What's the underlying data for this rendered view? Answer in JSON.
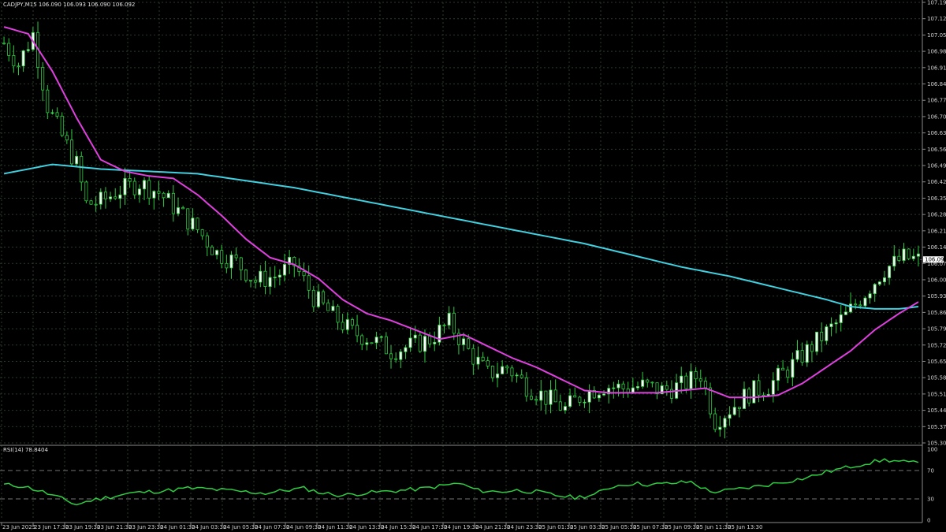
{
  "header": {
    "symbol": "CADJPY,M15",
    "ohlc": "106.090 106.093 106.090 106.092"
  },
  "rsi_header": "RSI(14) 78.8404",
  "colors": {
    "background": "#000000",
    "grid": "#2a3a2a",
    "bull_candle": "#ffffff",
    "bear_candle": "#000000",
    "candle_wick": "#2ecc40",
    "ma_fast": "#e040e0",
    "ma_slow": "#40d0e0",
    "rsi_line": "#2ecc40",
    "axis_text": "#d0d0d0",
    "price_tag_bg": "#ffffff"
  },
  "chart_data": [
    {
      "type": "candlestick",
      "title": "CADJPY,M15",
      "price_ticks": [
        "107.195",
        "107.125",
        "107.055",
        "106.985",
        "106.915",
        "106.845",
        "106.775",
        "106.705",
        "106.635",
        "106.565",
        "106.495",
        "106.425",
        "106.355",
        "106.285",
        "106.215",
        "106.145",
        "106.075",
        "106.005",
        "105.935",
        "105.865",
        "105.795",
        "105.725",
        "105.655",
        "105.585",
        "105.515",
        "105.445",
        "105.375",
        "105.305"
      ],
      "ylim": [
        105.305,
        107.195
      ],
      "current_price": "106.092",
      "time_labels": [
        "23 Jun 2025",
        "23 Jun 17:30",
        "23 Jun 19:30",
        "23 Jun 21:30",
        "23 Jun 23:30",
        "24 Jun 01:30",
        "24 Jun 03:30",
        "24 Jun 05:30",
        "24 Jun 07:30",
        "24 Jun 09:30",
        "24 Jun 11:30",
        "24 Jun 13:30",
        "24 Jun 15:30",
        "24 Jun 17:30",
        "24 Jun 19:30",
        "24 Jun 21:30",
        "24 Jun 23:30",
        "25 Jun 01:30",
        "25 Jun 03:30",
        "25 Jun 05:30",
        "25 Jun 07:30",
        "25 Jun 09:30",
        "25 Jun 11:30",
        "25 Jun 13:30"
      ],
      "close_anchors": [
        [
          0,
          107.02
        ],
        [
          3,
          106.93
        ],
        [
          6,
          107.06
        ],
        [
          9,
          106.75
        ],
        [
          12,
          106.62
        ],
        [
          15,
          106.5
        ],
        [
          17,
          106.33
        ],
        [
          20,
          106.34
        ],
        [
          24,
          106.39
        ],
        [
          28,
          106.42
        ],
        [
          32,
          106.38
        ],
        [
          36,
          106.3
        ],
        [
          40,
          106.22
        ],
        [
          44,
          106.12
        ],
        [
          48,
          106.08
        ],
        [
          52,
          106.0
        ],
        [
          56,
          106.02
        ],
        [
          60,
          106.07
        ],
        [
          64,
          105.93
        ],
        [
          68,
          105.85
        ],
        [
          72,
          105.78
        ],
        [
          76,
          105.75
        ],
        [
          80,
          105.7
        ],
        [
          84,
          105.72
        ],
        [
          88,
          105.75
        ],
        [
          92,
          105.82
        ],
        [
          96,
          105.7
        ],
        [
          100,
          105.6
        ],
        [
          104,
          105.63
        ],
        [
          108,
          105.55
        ],
        [
          112,
          105.5
        ],
        [
          116,
          105.45
        ],
        [
          120,
          105.52
        ],
        [
          124,
          105.55
        ],
        [
          128,
          105.54
        ],
        [
          132,
          105.55
        ],
        [
          136,
          105.53
        ],
        [
          140,
          105.55
        ],
        [
          144,
          105.6
        ],
        [
          147,
          105.4
        ],
        [
          150,
          105.45
        ],
        [
          154,
          105.52
        ],
        [
          158,
          105.55
        ],
        [
          162,
          105.62
        ],
        [
          166,
          105.7
        ],
        [
          170,
          105.78
        ],
        [
          174,
          105.85
        ],
        [
          178,
          105.95
        ],
        [
          182,
          106.05
        ],
        [
          186,
          106.1
        ],
        [
          189,
          106.09
        ]
      ],
      "ma_fast_anchors": [
        [
          0,
          107.09
        ],
        [
          5,
          107.06
        ],
        [
          10,
          106.9
        ],
        [
          15,
          106.7
        ],
        [
          20,
          106.52
        ],
        [
          25,
          106.47
        ],
        [
          30,
          106.45
        ],
        [
          35,
          106.44
        ],
        [
          40,
          106.37
        ],
        [
          45,
          106.28
        ],
        [
          50,
          106.18
        ],
        [
          55,
          106.1
        ],
        [
          60,
          106.07
        ],
        [
          65,
          106.01
        ],
        [
          70,
          105.92
        ],
        [
          75,
          105.86
        ],
        [
          80,
          105.83
        ],
        [
          85,
          105.79
        ],
        [
          90,
          105.75
        ],
        [
          95,
          105.77
        ],
        [
          100,
          105.72
        ],
        [
          105,
          105.67
        ],
        [
          110,
          105.63
        ],
        [
          115,
          105.58
        ],
        [
          120,
          105.53
        ],
        [
          125,
          105.52
        ],
        [
          130,
          105.52
        ],
        [
          135,
          105.52
        ],
        [
          140,
          105.53
        ],
        [
          145,
          105.54
        ],
        [
          150,
          105.5
        ],
        [
          155,
          105.5
        ],
        [
          160,
          105.51
        ],
        [
          165,
          105.56
        ],
        [
          170,
          105.63
        ],
        [
          175,
          105.7
        ],
        [
          180,
          105.79
        ],
        [
          185,
          105.86
        ],
        [
          189,
          105.91
        ]
      ],
      "ma_slow_anchors": [
        [
          0,
          106.46
        ],
        [
          10,
          106.5
        ],
        [
          20,
          106.48
        ],
        [
          30,
          106.47
        ],
        [
          40,
          106.46
        ],
        [
          50,
          106.43
        ],
        [
          60,
          106.4
        ],
        [
          70,
          106.36
        ],
        [
          80,
          106.32
        ],
        [
          90,
          106.28
        ],
        [
          100,
          106.24
        ],
        [
          110,
          106.2
        ],
        [
          120,
          106.16
        ],
        [
          130,
          106.11
        ],
        [
          140,
          106.06
        ],
        [
          150,
          106.02
        ],
        [
          160,
          105.97
        ],
        [
          170,
          105.92
        ],
        [
          175,
          105.89
        ],
        [
          180,
          105.88
        ],
        [
          185,
          105.88
        ],
        [
          189,
          105.89
        ]
      ],
      "series": [
        {
          "name": "",
          "kind": "ma_fast"
        },
        {
          "name": "",
          "kind": "ma_slow"
        }
      ],
      "bars": 190
    },
    {
      "type": "line",
      "title": "RSI(14) 78.8404",
      "ylim": [
        0,
        100
      ],
      "ticks": [
        "100",
        "70",
        "30",
        "0"
      ],
      "levels": [
        70,
        30
      ],
      "rsi_anchors": [
        [
          0,
          50
        ],
        [
          4,
          48
        ],
        [
          8,
          40
        ],
        [
          12,
          30
        ],
        [
          15,
          22
        ],
        [
          18,
          28
        ],
        [
          22,
          33
        ],
        [
          26,
          38
        ],
        [
          30,
          40
        ],
        [
          34,
          42
        ],
        [
          38,
          45
        ],
        [
          42,
          44
        ],
        [
          46,
          42
        ],
        [
          50,
          40
        ],
        [
          54,
          38
        ],
        [
          58,
          42
        ],
        [
          62,
          45
        ],
        [
          66,
          38
        ],
        [
          70,
          35
        ],
        [
          74,
          38
        ],
        [
          78,
          40
        ],
        [
          82,
          42
        ],
        [
          86,
          44
        ],
        [
          90,
          48
        ],
        [
          94,
          52
        ],
        [
          98,
          42
        ],
        [
          102,
          40
        ],
        [
          106,
          42
        ],
        [
          110,
          40
        ],
        [
          114,
          35
        ],
        [
          118,
          32
        ],
        [
          122,
          36
        ],
        [
          126,
          48
        ],
        [
          130,
          52
        ],
        [
          134,
          50
        ],
        [
          138,
          52
        ],
        [
          142,
          54
        ],
        [
          146,
          40
        ],
        [
          150,
          42
        ],
        [
          154,
          46
        ],
        [
          158,
          50
        ],
        [
          162,
          55
        ],
        [
          166,
          60
        ],
        [
          170,
          68
        ],
        [
          174,
          74
        ],
        [
          178,
          80
        ],
        [
          182,
          85
        ],
        [
          186,
          82
        ],
        [
          189,
          80
        ]
      ]
    }
  ]
}
